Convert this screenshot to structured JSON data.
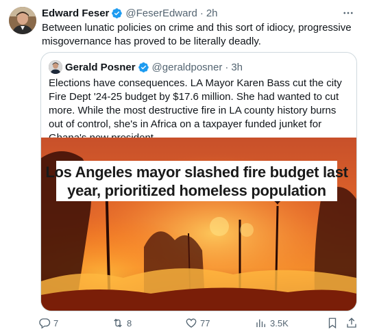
{
  "tweet": {
    "author_name": "Edward Feser",
    "handle": "@FeserEdward",
    "separator": "·",
    "time": "2h",
    "text": "Between lunatic policies on crime and this sort of idiocy, progressive misgovernance has proved to be literally deadly.",
    "more_icon": "more-horizontal-icon",
    "verified_color": "#1d9bf0"
  },
  "quote": {
    "author_name": "Gerald Posner",
    "handle": "@geraldposner",
    "separator": "·",
    "time": "3h",
    "text": "Elections have consequences. LA Mayor Karen Bass cut the city Fire Dept '24-25 budget by $17.6 million. She had wanted to cut more. While the most destructive fire in LA county history burns out of control, she's in Africa on a taxpayer funded junket for Ghana's new president.",
    "image": {
      "headline_line1": "Los Angeles mayor slashed fire budget last",
      "headline_line2": "year, prioritized homeless population"
    }
  },
  "actions": {
    "reply": {
      "icon": "reply-icon",
      "count": "7"
    },
    "retweet": {
      "icon": "retweet-icon",
      "count": "8"
    },
    "like": {
      "icon": "heart-icon",
      "count": "77"
    },
    "views": {
      "icon": "analytics-icon",
      "count": "3.5K"
    },
    "bookmark": {
      "icon": "bookmark-icon"
    },
    "share": {
      "icon": "share-icon"
    }
  }
}
